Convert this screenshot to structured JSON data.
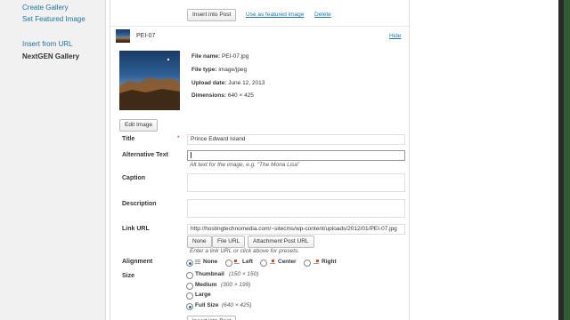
{
  "sidebar": {
    "links": [
      {
        "label": "Create Gallery"
      },
      {
        "label": "Set Featured Image"
      },
      {
        "label": "Insert from URL"
      }
    ],
    "active": "NextGEN Gallery"
  },
  "top_actions": {
    "insert_label": "Insert into Post",
    "featured_label": "Use as featured image",
    "delete_label": "Delete"
  },
  "item": {
    "name": "PEI-07",
    "toggle_label": "Hide"
  },
  "file_info": {
    "file_name_label": "File name:",
    "file_name": "PEI-07.jpg",
    "file_type_label": "File type:",
    "file_type": "image/jpeg",
    "upload_date_label": "Upload date:",
    "upload_date": "June 12, 2013",
    "dimensions_label": "Dimensions:",
    "dimensions": "640 × 425"
  },
  "edit_image_label": "Edit Image",
  "fields": {
    "title_label": "Title",
    "required_mark": "*",
    "title_value": "Prince Edward Island",
    "alt_label": "Alternative Text",
    "alt_value": "",
    "alt_help": "Alt text for the image, e.g. “The Mona Lisa”",
    "caption_label": "Caption",
    "description_label": "Description",
    "link_label": "Link URL",
    "link_value": "http://hostingtechnomedia.com/~sitecms/wp-content/uploads/2012/01/PEI-07.jpg",
    "link_buttons": [
      "None",
      "File URL",
      "Attachment Post URL"
    ],
    "link_help": "Enter a link URL or click above for presets."
  },
  "alignment": {
    "label": "Alignment",
    "options": [
      "None",
      "Left",
      "Center",
      "Right"
    ],
    "selected": "None"
  },
  "size": {
    "label": "Size",
    "options": [
      {
        "name": "Thumbnail",
        "dims": "(150 × 150)"
      },
      {
        "name": "Medium",
        "dims": "(300 × 199)"
      },
      {
        "name": "Large",
        "dims": ""
      },
      {
        "name": "Full Size",
        "dims": "(640 × 425)"
      }
    ],
    "selected": "Full Size"
  }
}
